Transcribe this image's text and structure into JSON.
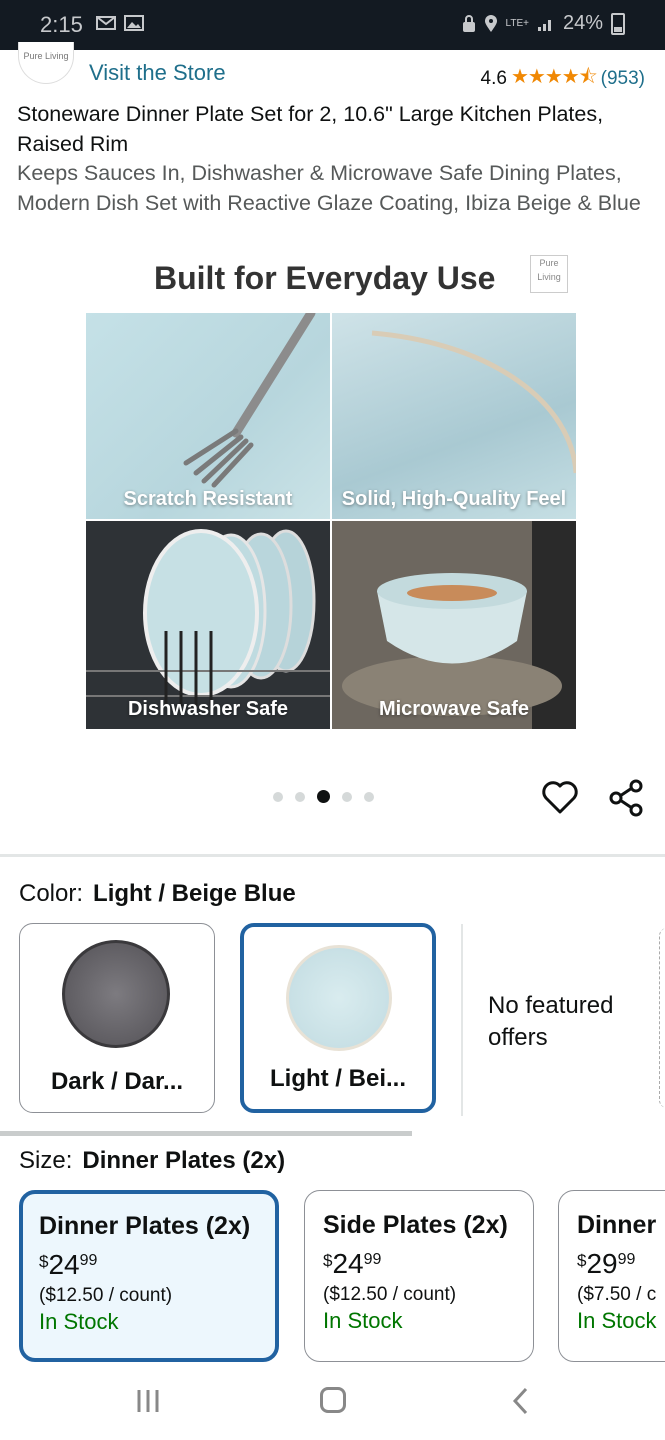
{
  "status_bar": {
    "time": "2:15",
    "network": "LTE+",
    "battery": "24%"
  },
  "store": {
    "logo_text": "Pure Living",
    "visit_label": "Visit the Store",
    "rating_value": "4.6",
    "stars": "★★★★⯪",
    "rating_count": "(953)"
  },
  "product": {
    "title_bold": "Stoneware Dinner Plate Set for 2, 10.6\" Large Kitchen Plates, Raised Rim",
    "title_rest": "Keeps Sauces In, Dishwasher & Microwave Safe Dining Plates, Modern Dish Set with Reactive Glaze Coating, Ibiza Beige & Blue"
  },
  "hero": {
    "heading": "Built for Everyday Use",
    "logo_text": "Pure Living",
    "tiles": [
      {
        "label": "Scratch Resistant"
      },
      {
        "label": "Solid, High-Quality Feel"
      },
      {
        "label": "Dishwasher Safe"
      },
      {
        "label": "Microwave Safe"
      }
    ],
    "carousel": {
      "count": 5,
      "active_index": 2
    }
  },
  "actions": {
    "wishlist_icon": "heart-icon",
    "share_icon": "share-icon"
  },
  "color": {
    "label": "Color:",
    "selected": "Light / Beige Blue",
    "options": [
      {
        "name": "Dark / Dar...",
        "plate_color": "#6e6c70",
        "selected": false
      },
      {
        "name": "Light / Bei...",
        "plate_color": "#cfe5ea",
        "selected": true
      }
    ],
    "no_offers": "No featured offers"
  },
  "size": {
    "label": "Size:",
    "selected": "Dinner Plates (2x)",
    "options": [
      {
        "title": "Dinner Plates (2x)",
        "currency": "$",
        "price_whole": "24",
        "price_cents": "99",
        "unit_price": "($12.50 / count)",
        "stock": "In Stock",
        "selected": true
      },
      {
        "title": "Side Plates (2x)",
        "currency": "$",
        "price_whole": "24",
        "price_cents": "99",
        "unit_price": "($12.50 / count)",
        "stock": "In Stock",
        "selected": false
      },
      {
        "title": "Dinner",
        "currency": "$",
        "price_whole": "29",
        "price_cents": "99",
        "unit_price": "($7.50 / c",
        "stock": "In Stock",
        "selected": false
      }
    ]
  },
  "colors": {
    "link": "#1f6f8b",
    "selected_border": "#2162a1",
    "in_stock": "#007600",
    "star": "#f08804"
  }
}
